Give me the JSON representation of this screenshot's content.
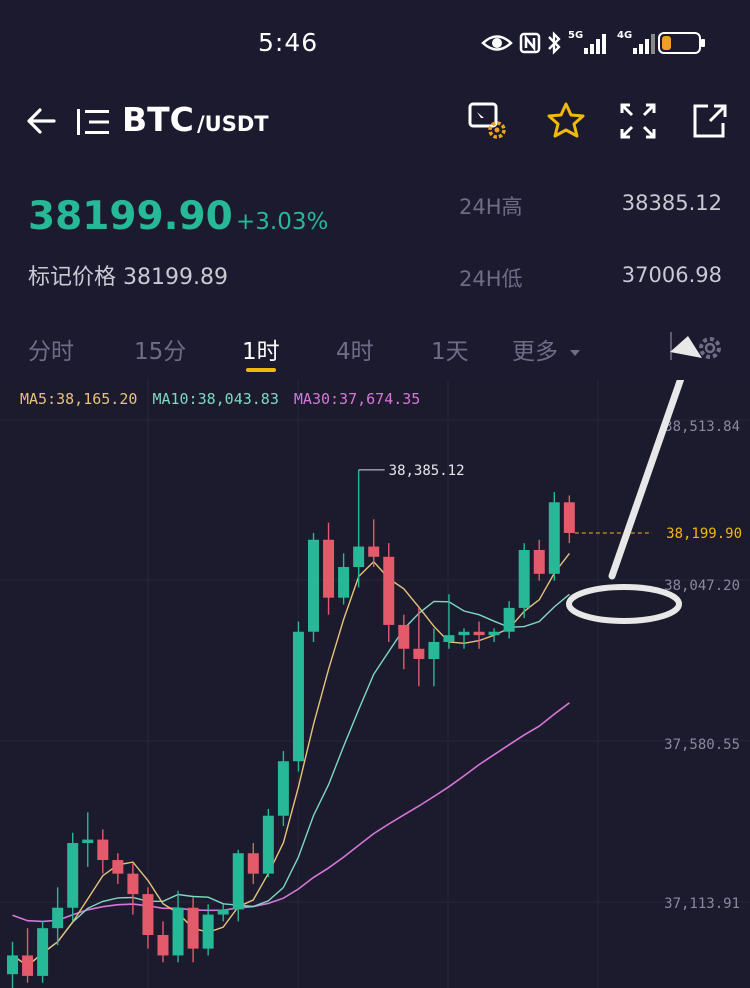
{
  "status_bar": {
    "time": "5:46",
    "icons": [
      "eye-icon",
      "nfc-icon",
      "bluetooth-icon",
      "5g-signal-icon",
      "4g-signal-icon",
      "battery-icon"
    ],
    "network_1": "5G",
    "network_2": "4G",
    "battery_color": "#f0a020"
  },
  "header": {
    "pair_base": "BTC",
    "pair_quote": "/USDT",
    "icons": [
      "back-arrow-icon",
      "menu-icon",
      "chart-settings-icon",
      "star-icon",
      "fullscreen-icon",
      "share-icon"
    ]
  },
  "ticker": {
    "last_price": "38199.90",
    "change_pct": "+3.03%",
    "mark_price_label": "标记价格",
    "mark_price": "38199.89",
    "high_label": "24H高",
    "high_value": "38385.12",
    "low_label": "24H低",
    "low_value": "37006.98",
    "up_color": "#26b897",
    "down_color": "#e35a6a"
  },
  "tabs": [
    {
      "label": "分时",
      "active": false
    },
    {
      "label": "15分",
      "active": false
    },
    {
      "label": "1时",
      "active": true
    },
    {
      "label": "4时",
      "active": false
    },
    {
      "label": "1天",
      "active": false
    },
    {
      "label": "更多",
      "active": false
    }
  ],
  "ma_legend": {
    "ma5": "MA5:38,165.20",
    "ma10": "MA10:38,043.83",
    "ma30": "MA30:37,674.35"
  },
  "chart_data": {
    "type": "candlestick",
    "y_ticks": [
      "38,513.84",
      "38,047.20",
      "37,580.55",
      "37,113.91"
    ],
    "y_tick_values": [
      38513.84,
      38047.2,
      37580.55,
      37113.91
    ],
    "high_marker": "38,385.12",
    "current_price_label": "38,199.90",
    "current_price": 38199.9,
    "candles": [
      {
        "o": 36905,
        "h": 37000,
        "l": 36860,
        "c": 36960
      },
      {
        "o": 36960,
        "h": 37040,
        "l": 36880,
        "c": 36900
      },
      {
        "o": 36900,
        "h": 37060,
        "l": 36880,
        "c": 37040
      },
      {
        "o": 37040,
        "h": 37160,
        "l": 36990,
        "c": 37100
      },
      {
        "o": 37100,
        "h": 37320,
        "l": 37060,
        "c": 37290
      },
      {
        "o": 37290,
        "h": 37380,
        "l": 37220,
        "c": 37300
      },
      {
        "o": 37300,
        "h": 37330,
        "l": 37200,
        "c": 37240
      },
      {
        "o": 37240,
        "h": 37260,
        "l": 37170,
        "c": 37200
      },
      {
        "o": 37200,
        "h": 37230,
        "l": 37080,
        "c": 37140
      },
      {
        "o": 37140,
        "h": 37160,
        "l": 36980,
        "c": 37020
      },
      {
        "o": 37020,
        "h": 37060,
        "l": 36940,
        "c": 36960
      },
      {
        "o": 36960,
        "h": 37150,
        "l": 36940,
        "c": 37100
      },
      {
        "o": 37100,
        "h": 37130,
        "l": 36940,
        "c": 36980
      },
      {
        "o": 36980,
        "h": 37110,
        "l": 36960,
        "c": 37080
      },
      {
        "o": 37080,
        "h": 37110,
        "l": 37060,
        "c": 37095
      },
      {
        "o": 37095,
        "h": 37270,
        "l": 37060,
        "c": 37260
      },
      {
        "o": 37260,
        "h": 37290,
        "l": 37170,
        "c": 37200
      },
      {
        "o": 37200,
        "h": 37390,
        "l": 37190,
        "c": 37370
      },
      {
        "o": 37370,
        "h": 37560,
        "l": 37340,
        "c": 37530
      },
      {
        "o": 37530,
        "h": 37940,
        "l": 37500,
        "c": 37910
      },
      {
        "o": 37910,
        "h": 38200,
        "l": 37880,
        "c": 38180
      },
      {
        "o": 38180,
        "h": 38230,
        "l": 37960,
        "c": 38010
      },
      {
        "o": 38010,
        "h": 38140,
        "l": 37990,
        "c": 38100
      },
      {
        "o": 38100,
        "h": 38385.12,
        "l": 38040,
        "c": 38160
      },
      {
        "o": 38160,
        "h": 38240,
        "l": 38100,
        "c": 38130
      },
      {
        "o": 38130,
        "h": 38170,
        "l": 37880,
        "c": 37930
      },
      {
        "o": 37930,
        "h": 37960,
        "l": 37800,
        "c": 37860
      },
      {
        "o": 37860,
        "h": 37980,
        "l": 37750,
        "c": 37830
      },
      {
        "o": 37830,
        "h": 37920,
        "l": 37750,
        "c": 37880
      },
      {
        "o": 37880,
        "h": 38020,
        "l": 37860,
        "c": 37900
      },
      {
        "o": 37900,
        "h": 37920,
        "l": 37860,
        "c": 37910
      },
      {
        "o": 37910,
        "h": 37940,
        "l": 37860,
        "c": 37900
      },
      {
        "o": 37900,
        "h": 37920,
        "l": 37880,
        "c": 37910
      },
      {
        "o": 37910,
        "h": 38000,
        "l": 37890,
        "c": 37980
      },
      {
        "o": 37980,
        "h": 38170,
        "l": 37950,
        "c": 38150
      },
      {
        "o": 38150,
        "h": 38180,
        "l": 38060,
        "c": 38080
      },
      {
        "o": 38080,
        "h": 38320,
        "l": 38060,
        "c": 38290
      },
      {
        "o": 38290,
        "h": 38310,
        "l": 38170,
        "c": 38199.9
      }
    ],
    "ma_colors": {
      "ma5": "#e6c27a",
      "ma10": "#7ed8c3",
      "ma30": "#d676d8"
    },
    "annotation": {
      "type": "arrow-and-ellipse",
      "color": "#e8e8e8"
    }
  }
}
